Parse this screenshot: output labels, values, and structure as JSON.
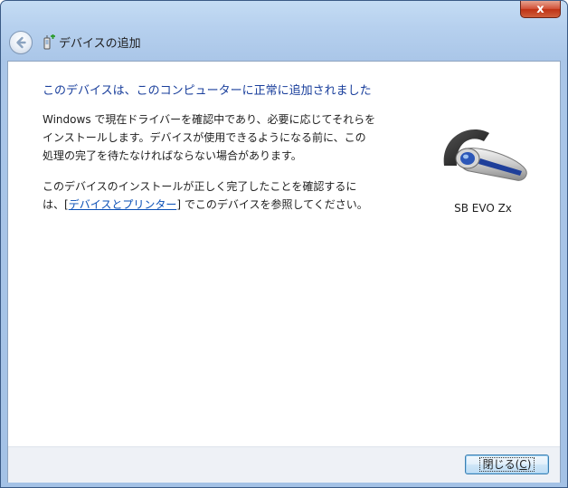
{
  "titlebar": {
    "close_glyph": "x"
  },
  "header": {
    "title": "デバイスの追加",
    "back_icon": "back-arrow-icon",
    "app_icon": "add-device-icon"
  },
  "content": {
    "headline": "このデバイスは、このコンピューターに正常に追加されました",
    "para1": [
      "Windows で現在ドライバーを確認中であり、必要に応じてそれらを",
      "インストールします。デバイスが使用できるようになる前に、この",
      "処理の完了を待たなければならない場合があります。"
    ],
    "para2_line1": "このデバイスのインストールが正しく完了したことを確認するに",
    "para2_line2_prefix": "は、[",
    "para2_link": "デバイスとプリンター",
    "para2_line2_suffix": "] でこのデバイスを参照してください。"
  },
  "device": {
    "icon": "bluetooth-headset-icon",
    "name": "SB EVO Zx"
  },
  "footer": {
    "close_label": "閉じる(",
    "close_accel": "C",
    "close_suffix": ")"
  },
  "colors": {
    "headline": "#1a3f9c",
    "link": "#0a4fb6",
    "close_button_red": "#c9401f"
  }
}
